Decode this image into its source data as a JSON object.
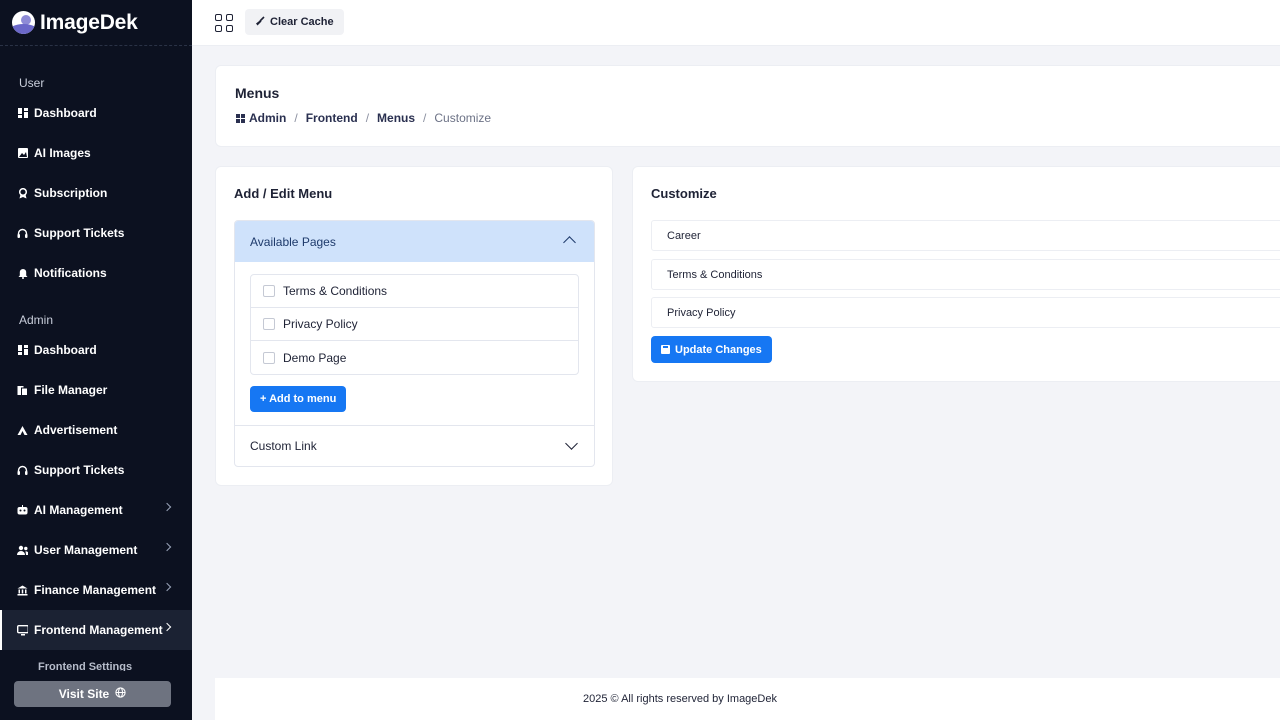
{
  "brand": {
    "name": "ImageDek"
  },
  "sidebar": {
    "user_section": "User",
    "user_items": [
      {
        "label": "Dashboard",
        "icon": "dashboard-icon"
      },
      {
        "label": "AI Images",
        "icon": "image-icon"
      },
      {
        "label": "Subscription",
        "icon": "badge-icon"
      },
      {
        "label": "Support Tickets",
        "icon": "headset-icon"
      },
      {
        "label": "Notifications",
        "icon": "bell-icon"
      }
    ],
    "admin_section": "Admin",
    "admin_items": [
      {
        "label": "Dashboard",
        "icon": "dashboard-icon"
      },
      {
        "label": "File Manager",
        "icon": "files-icon"
      },
      {
        "label": "Advertisement",
        "icon": "ads-icon"
      },
      {
        "label": "Support Tickets",
        "icon": "headset-icon"
      },
      {
        "label": "AI Management",
        "icon": "ai-icon",
        "expandable": true
      },
      {
        "label": "User Management",
        "icon": "users-icon",
        "expandable": true
      },
      {
        "label": "Finance Management",
        "icon": "bank-icon",
        "expandable": true
      },
      {
        "label": "Frontend Management",
        "icon": "monitor-icon",
        "expandable": true,
        "active": true
      }
    ],
    "submenu_peek": "Frontend Settings",
    "visit_site": "Visit Site"
  },
  "topbar": {
    "clear_cache": "Clear Cache"
  },
  "header": {
    "title": "Menus",
    "breadcrumb": [
      "Admin",
      "Frontend",
      "Menus",
      "Customize"
    ]
  },
  "add_edit": {
    "title": "Add / Edit Menu",
    "available_pages_label": "Available Pages",
    "pages": [
      "Terms & Conditions",
      "Privacy Policy",
      "Demo Page"
    ],
    "add_button": "+ Add to menu",
    "custom_link_label": "Custom Link"
  },
  "customize": {
    "title": "Customize",
    "items": [
      "Career",
      "Terms & Conditions",
      "Privacy Policy"
    ],
    "update_button": "Update Changes"
  },
  "footer": {
    "text": "2025 © All rights reserved by ImageDek"
  },
  "colors": {
    "sidebar_bg": "#0c1120",
    "accent": "#1677f3",
    "accordion_head": "#cfe2fb"
  }
}
